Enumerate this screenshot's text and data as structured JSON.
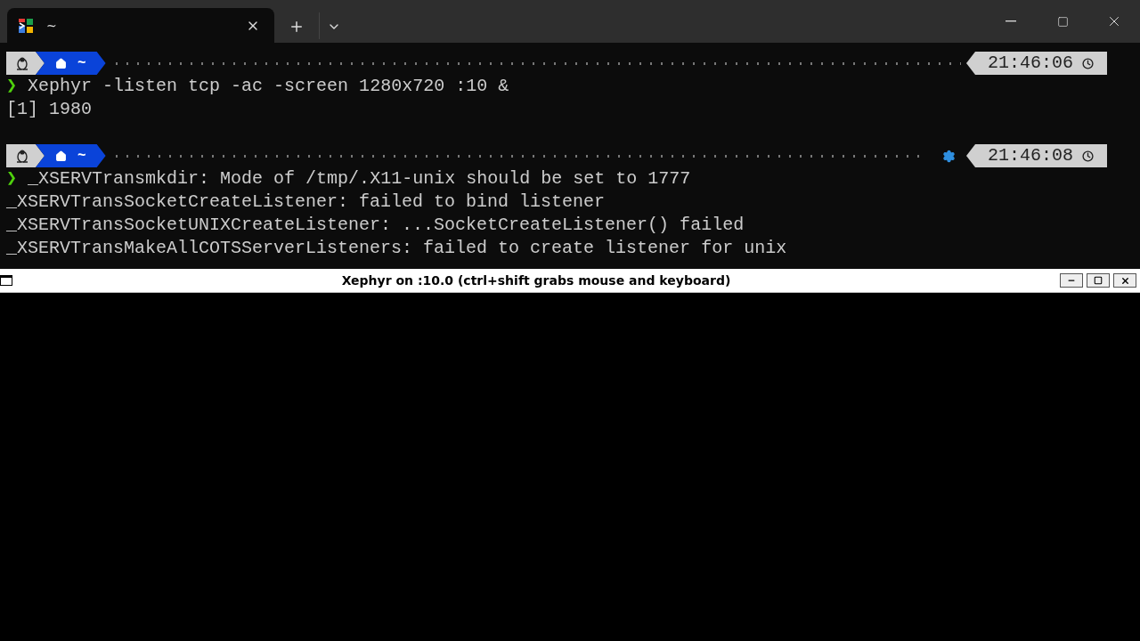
{
  "tabs": [
    {
      "title": "~",
      "selected": true
    }
  ],
  "prompts": [
    {
      "path": "~",
      "job_indicator": false,
      "time": "21:46:06",
      "symbol": "❯",
      "command": "Xephyr -listen tcp -ac -screen 1280x720 :10 &",
      "output": [
        "[1] 1980"
      ]
    },
    {
      "path": "~",
      "job_indicator": true,
      "time": "21:46:08",
      "symbol": "❯",
      "command": "_XSERVTransmkdir: Mode of /tmp/.X11-unix should be set to 1777",
      "output": [
        "_XSERVTransSocketCreateListener: failed to bind listener",
        "_XSERVTransSocketUNIXCreateListener: ...SocketCreateListener() failed",
        "_XSERVTransMakeAllCOTSServerListeners: failed to create listener for unix"
      ]
    }
  ],
  "xephyr": {
    "title": "Xephyr on :10.0 (ctrl+shift grabs mouse and keyboard)"
  }
}
